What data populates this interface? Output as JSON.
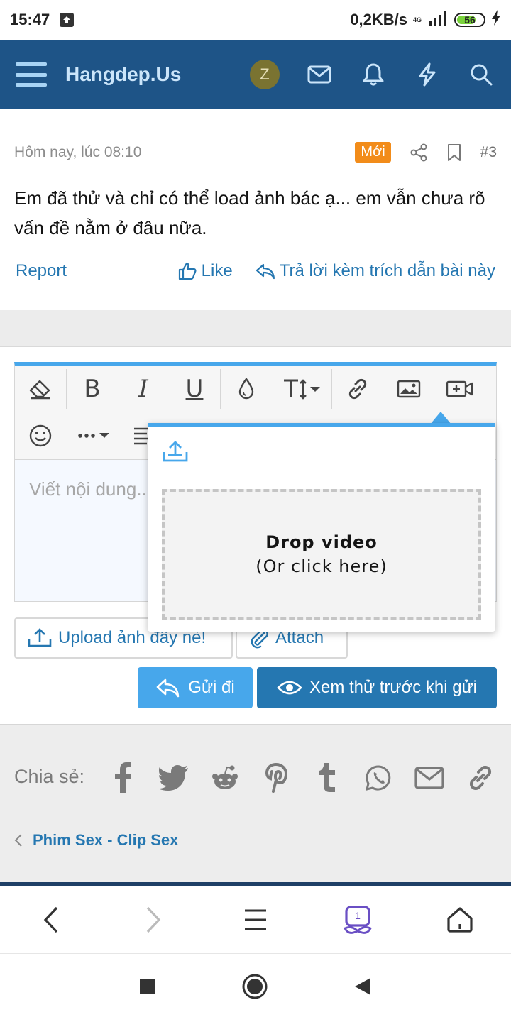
{
  "status_bar": {
    "time": "15:47",
    "network_speed": "0,2KB/s",
    "network_type": "4G",
    "battery": "56"
  },
  "header": {
    "brand": "Hangdep.Us",
    "avatar_letter": "Z"
  },
  "post": {
    "date": "Hôm nay, lúc 08:10",
    "badge": "Mới",
    "number": "#3",
    "text": "Em đã thử và chỉ có thể load ảnh bác ạ... em vẫn chưa rõ vấn đề nằm ở đâu nữa.",
    "report": "Report",
    "like": "Like",
    "quote_reply": "Trả lời kèm trích dẫn bài này"
  },
  "editor": {
    "placeholder": "Viết nội dung..."
  },
  "buttons": {
    "upload_image": "Upload ảnh đây nè!",
    "attach": "Attach",
    "send": "Gửi đi",
    "preview": "Xem thử trước khi gửi"
  },
  "video_popup": {
    "drop_title": "Drop video",
    "drop_sub": "(Or click here)"
  },
  "share": {
    "label": "Chia sẻ:",
    "breadcrumb": "Phim Sex - Clip Sex"
  },
  "browser_nav": {
    "tab_count": "1"
  },
  "colors": {
    "header": "#1e5487",
    "accent": "#47a7eb",
    "primary_button": "#2577b1",
    "badge": "#f28c1a"
  }
}
